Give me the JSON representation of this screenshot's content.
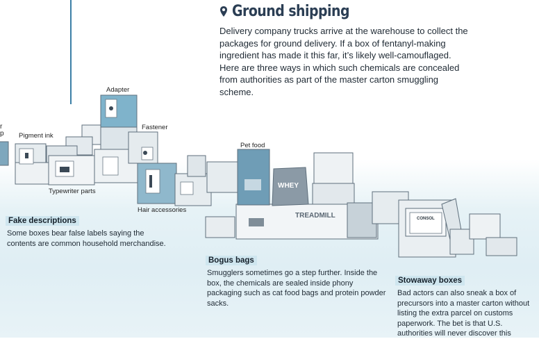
{
  "header": {
    "icon": "location-pin-icon",
    "title": "Ground shipping",
    "intro": "Delivery company trucks arrive at the warehouse to collect the packages for ground delivery. If a box of fentanyl-making ingredient has made it this far, it’s likely well-camouflaged. Here are three ways in which such chemicals are concealed from authorities as part of the master carton smuggling scheme."
  },
  "left_fragments": [
    "r",
    "p"
  ],
  "item_labels": {
    "adapter": "Adapter",
    "pigment_ink": "Pigment ink",
    "fastener": "Fastener",
    "typewriter_parts": "Typewriter parts",
    "hair_accessories": "Hair accessories",
    "pet_food": "Pet food"
  },
  "package_text": {
    "whey": "WHEY",
    "treadmill": "TREADMILL",
    "consol": "CONSOL"
  },
  "sections": [
    {
      "title": "Fake descriptions",
      "text": "Some boxes bear false labels saying the contents are common household merchandise."
    },
    {
      "title": "Bogus bags",
      "text": "Smugglers sometimes go a step further. Inside the box, the chemicals are sealed inside phony packaging such as cat food bags and protein powder sacks."
    },
    {
      "title": "Stowaway boxes",
      "text": "Bad actors can also sneak a box of precursors into a master carton without listing the extra parcel on customs paperwork. The bet is that U.S. authorities will never discover this"
    }
  ],
  "colors": {
    "accent": "#3b7fa6",
    "tag_bg": "#cfe6ef",
    "title": "#2b3e54"
  }
}
